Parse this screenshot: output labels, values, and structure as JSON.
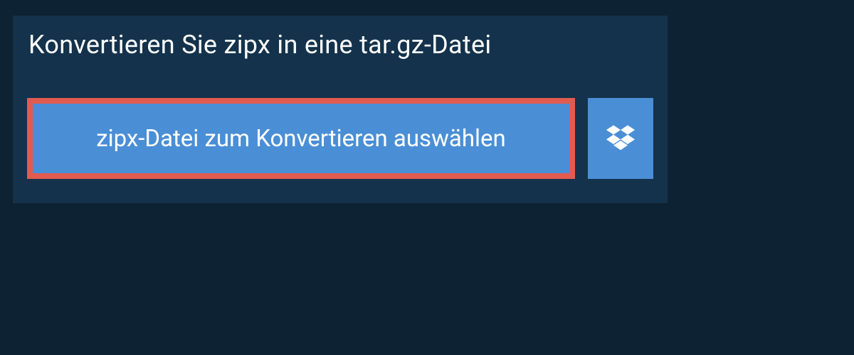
{
  "title": "Konvertieren Sie zipx in eine tar.gz-Datei",
  "actions": {
    "select_file_label": "zipx-Datei zum Konvertieren auswählen"
  },
  "colors": {
    "page_bg": "#0d2233",
    "panel_bg": "#14324b",
    "button_bg": "#4a8fd6",
    "highlight_border": "#e25b4f",
    "text": "#ffffff"
  }
}
